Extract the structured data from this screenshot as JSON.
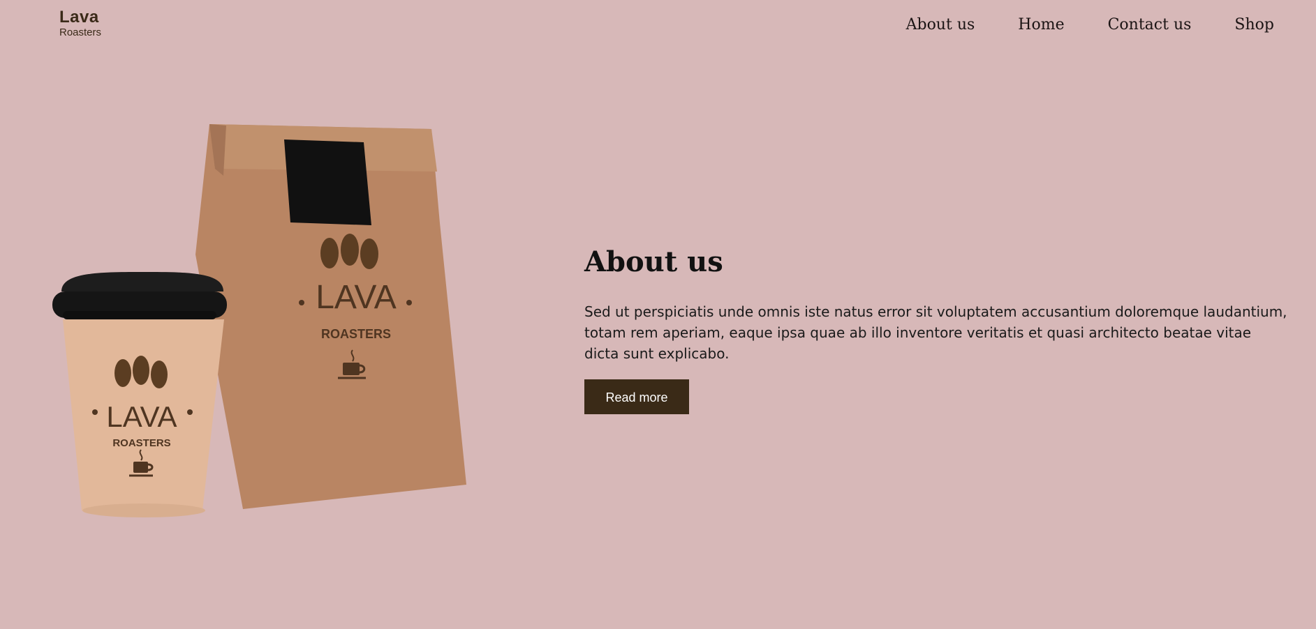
{
  "brand": {
    "name": "Lava",
    "tagline": "Roasters"
  },
  "nav": {
    "items": [
      "About us",
      "Home",
      "Contact us",
      "Shop"
    ]
  },
  "hero": {
    "title": "About us",
    "text": "Sed ut perspiciatis unde omnis iste natus error sit voluptatem accusantium doloremque laudantium, totam rem aperiam, eaque ipsa quae ab illo inventore veritatis et quasi architecto beatae vitae dicta sunt explicabo.",
    "button_label": "Read more"
  },
  "illustration": {
    "bag": {
      "brand": "LAVA",
      "subtitle": "ROASTERS"
    },
    "cup": {
      "brand": "LAVA",
      "subtitle": "ROASTERS"
    }
  },
  "colors": {
    "background": "#d7b8b8",
    "accent": "#3a2a17"
  }
}
